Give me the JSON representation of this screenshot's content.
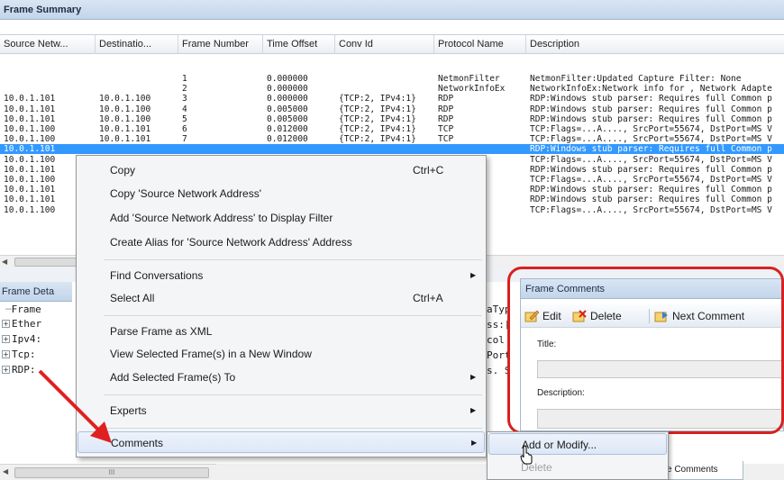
{
  "frame_summary": {
    "title": "Frame Summary",
    "columns": [
      "Source Netw...",
      "Destinatio...",
      "Frame Number",
      "Time Offset",
      "Conv Id",
      "Protocol Name",
      "Description"
    ],
    "rows": [
      {
        "src": "",
        "dst": "",
        "num": "1",
        "time": "0.000000",
        "conv": "",
        "proto": "NetmonFilter",
        "desc": "NetmonFilter:Updated Capture Filter: None"
      },
      {
        "src": "",
        "dst": "",
        "num": "2",
        "time": "0.000000",
        "conv": "",
        "proto": "NetworkInfoEx",
        "desc": "NetworkInfoEx:Network info for , Network Adapte"
      },
      {
        "src": "10.0.1.101",
        "dst": "10.0.1.100",
        "num": "3",
        "time": "0.000000",
        "conv": "{TCP:2, IPv4:1}",
        "proto": "RDP",
        "desc": "RDP:Windows stub parser: Requires full Common p"
      },
      {
        "src": "10.0.1.101",
        "dst": "10.0.1.100",
        "num": "4",
        "time": "0.005000",
        "conv": "{TCP:2, IPv4:1}",
        "proto": "RDP",
        "desc": "RDP:Windows stub parser: Requires full Common p"
      },
      {
        "src": "10.0.1.101",
        "dst": "10.0.1.100",
        "num": "5",
        "time": "0.005000",
        "conv": "{TCP:2, IPv4:1}",
        "proto": "RDP",
        "desc": "RDP:Windows stub parser: Requires full Common p"
      },
      {
        "src": "10.0.1.100",
        "dst": "10.0.1.101",
        "num": "6",
        "time": "0.012000",
        "conv": "{TCP:2, IPv4:1}",
        "proto": "TCP",
        "desc": "TCP:Flags=...A...., SrcPort=55674, DstPort=MS V"
      },
      {
        "src": "10.0.1.100",
        "dst": "10.0.1.101",
        "num": "7",
        "time": "0.012000",
        "conv": "{TCP:2, IPv4:1}",
        "proto": "TCP",
        "desc": "TCP:Flags=...A...., SrcPort=55674, DstPort=MS V"
      },
      {
        "src": "10.0.1.101",
        "dst": "",
        "num": "",
        "time": "",
        "conv": "",
        "proto": "",
        "desc": "RDP:Windows stub parser: Requires full Common p"
      },
      {
        "src": "10.0.1.100",
        "dst": "",
        "num": "",
        "time": "",
        "conv": "",
        "proto": "",
        "desc": "TCP:Flags=...A...., SrcPort=55674, DstPort=MS V"
      },
      {
        "src": "10.0.1.101",
        "dst": "",
        "num": "",
        "time": "",
        "conv": "",
        "proto": "",
        "desc": "RDP:Windows stub parser: Requires full Common p"
      },
      {
        "src": "10.0.1.100",
        "dst": "",
        "num": "",
        "time": "",
        "conv": "",
        "proto": "",
        "desc": "TCP:Flags=...A...., SrcPort=55674, DstPort=MS V"
      },
      {
        "src": "10.0.1.101",
        "dst": "",
        "num": "",
        "time": "",
        "conv": "",
        "proto": "",
        "desc": "RDP:Windows stub parser: Requires full Common p"
      },
      {
        "src": "10.0.1.101",
        "dst": "",
        "num": "",
        "time": "",
        "conv": "",
        "proto": "",
        "desc": "RDP:Windows stub parser: Requires full Common p"
      },
      {
        "src": "10.0.1.100",
        "dst": "",
        "num": "",
        "time": "",
        "conv": "",
        "proto": "",
        "desc": "TCP:Flags=...A...., SrcPort=55674, DstPort=MS V"
      }
    ],
    "selected_row": 7
  },
  "frame_details": {
    "title": "Frame Deta",
    "tree": [
      "Frame",
      "Ether",
      "Ipv4:",
      "Tcp:",
      "RDP:"
    ],
    "hex": [
      "aTyp",
      "ss:[",
      "col",
      "Port",
      "s. S"
    ]
  },
  "context_menu": {
    "items": [
      {
        "label": "Copy",
        "shortcut": "Ctrl+C"
      },
      {
        "label": "Copy 'Source Network Address'"
      },
      {
        "label": "Add 'Source Network Address' to Display Filter"
      },
      {
        "label": "Create Alias for 'Source Network Address' Address"
      },
      {
        "label": "Find Conversations",
        "arrow": "▶"
      },
      {
        "label": "Select All",
        "shortcut": "Ctrl+A"
      },
      {
        "label": "Parse Frame as XML"
      },
      {
        "label": "View Selected Frame(s) in a New Window"
      },
      {
        "label": "Add Selected Frame(s) To",
        "arrow": "▶"
      },
      {
        "label": "Experts",
        "arrow": "▶"
      },
      {
        "label": "Comments",
        "arrow": "▶"
      }
    ]
  },
  "submenu": {
    "add_modify": "Add or Modify...",
    "delete": "Delete"
  },
  "frame_comments": {
    "title": "Frame Comments",
    "edit": "Edit",
    "delete": "Delete",
    "next_comment": "Next Comment",
    "title_label": "Title:",
    "description_label": "Description:"
  },
  "bottom": {
    "scroll_grip": "III",
    "tab_label": "e Comments"
  },
  "colors": {
    "selection": "#3399ff",
    "highlight_oval": "#d82020",
    "arrow": "#e02020"
  }
}
